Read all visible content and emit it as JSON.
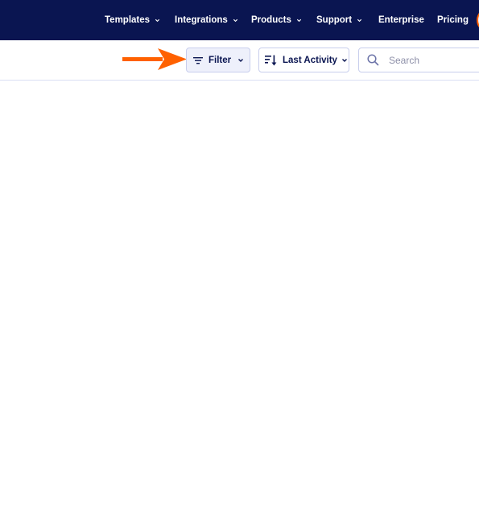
{
  "nav": {
    "items": [
      {
        "label": "Templates",
        "has_dropdown": true
      },
      {
        "label": "Integrations",
        "has_dropdown": true
      },
      {
        "label": "Products",
        "has_dropdown": true
      },
      {
        "label": "Support",
        "has_dropdown": true
      },
      {
        "label": "Enterprise",
        "has_dropdown": false
      },
      {
        "label": "Pricing",
        "has_dropdown": false
      }
    ],
    "background": "#0a1551"
  },
  "toolbar": {
    "filter": {
      "label": "Filter",
      "icon": "filter-lines-icon"
    },
    "sort": {
      "label": "Last Activity",
      "icon": "sort-descending-icon"
    },
    "search": {
      "placeholder": "Search",
      "value": "",
      "icon": "search-icon"
    }
  },
  "annotation": {
    "icon": "arrow-right-icon",
    "color": "#ff6100"
  },
  "colors": {
    "accent": "#ff6100",
    "navy": "#0a1551",
    "filter_bg": "#eef0fb",
    "border": "#c8ceed"
  }
}
